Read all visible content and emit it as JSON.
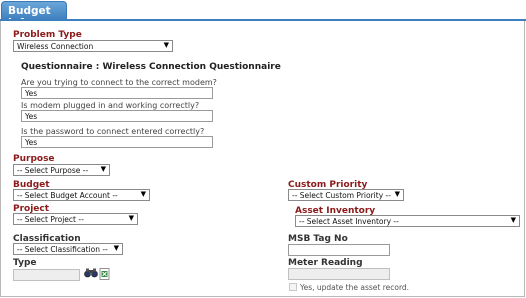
{
  "tab": {
    "label": "Budget Info"
  },
  "problem_type": {
    "label": "Problem Type",
    "value": "Wireless Connection"
  },
  "questionnaire": {
    "title": "Questionnaire : Wireless Connection Questionnaire",
    "questions": [
      {
        "text": "Are you trying to connect to the correct modem?",
        "answer": "Yes"
      },
      {
        "text": "Is modem plugged in and working correctly?",
        "answer": "Yes"
      },
      {
        "text": "Is the password to connect entered correctly?",
        "answer": "Yes"
      }
    ]
  },
  "purpose": {
    "label": "Purpose",
    "value": "-- Select Purpose --"
  },
  "budget": {
    "label": "Budget",
    "value": "-- Select Budget Account --"
  },
  "custom_priority": {
    "label": "Custom Priority",
    "value": "-- Select Custom Priority --"
  },
  "project": {
    "label": "Project",
    "value": "-- Select Project --"
  },
  "asset_inventory": {
    "label": "Asset Inventory",
    "value": "-- Select Asset Inventory --"
  },
  "classification": {
    "label": "Classification",
    "value": "-- Select Classification --"
  },
  "msb_tag": {
    "label": "MSB Tag No",
    "value": ""
  },
  "type": {
    "label": "Type",
    "value": "",
    "icons": [
      "binoculars-icon",
      "excel-icon"
    ]
  },
  "meter_reading": {
    "label": "Meter Reading",
    "value": ""
  },
  "update_asset": {
    "label": "Yes, update the asset record.",
    "checked": false
  },
  "colors": {
    "accent": "#3e7fc0",
    "label_red": "#8b1a1a"
  }
}
